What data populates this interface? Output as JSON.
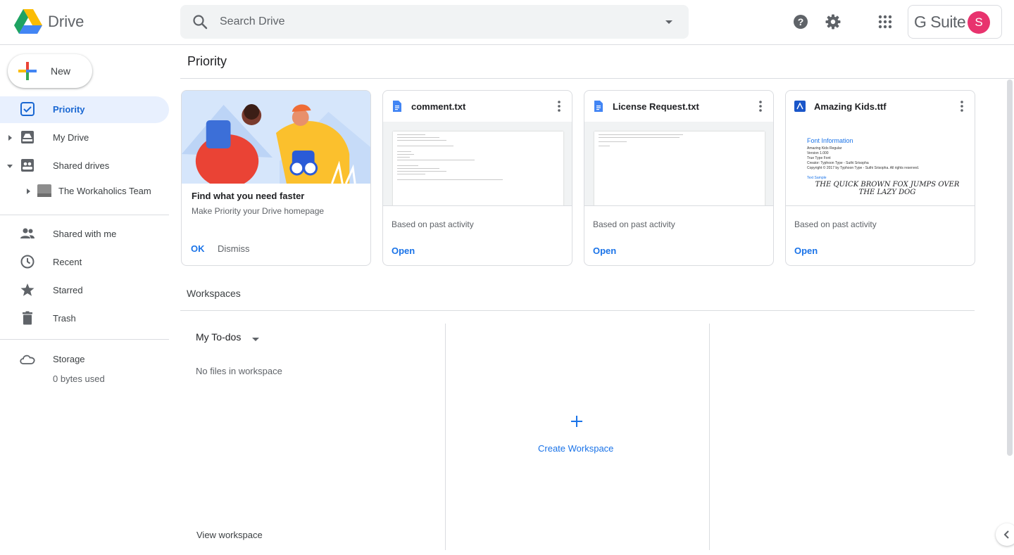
{
  "app": {
    "brand": "Drive"
  },
  "search": {
    "placeholder": "Search Drive"
  },
  "header": {
    "gsuite_label": "G Suite",
    "avatar_initial": "S"
  },
  "sidebar": {
    "new_label": "New",
    "items": [
      {
        "label": "Priority",
        "icon": "priority-check-icon",
        "active": true
      },
      {
        "label": "My Drive",
        "icon": "my-drive-icon"
      },
      {
        "label": "Shared drives",
        "icon": "shared-drives-icon"
      },
      {
        "label": "The Workaholics Team",
        "icon": "team-drive-icon"
      },
      {
        "label": "Shared with me",
        "icon": "people-icon"
      },
      {
        "label": "Recent",
        "icon": "clock-icon"
      },
      {
        "label": "Starred",
        "icon": "star-icon"
      },
      {
        "label": "Trash",
        "icon": "trash-icon"
      },
      {
        "label": "Storage",
        "icon": "cloud-icon"
      }
    ],
    "storage_used": "0 bytes used"
  },
  "main": {
    "title": "Priority",
    "promo": {
      "title": "Find what you need faster",
      "subtitle": "Make Priority your Drive homepage",
      "ok": "OK",
      "dismiss": "Dismiss"
    },
    "cards": [
      {
        "name": "comment.txt",
        "reason": "Based on past activity",
        "action": "Open",
        "icon": "doc-icon"
      },
      {
        "name": "License Request.txt",
        "reason": "Based on past activity",
        "action": "Open",
        "icon": "doc-icon"
      },
      {
        "name": "Amazing Kids.ttf",
        "reason": "Based on past activity",
        "action": "Open",
        "icon": "font-file-icon"
      }
    ],
    "font_preview": {
      "heading": "Font Information",
      "lines": [
        "Amazing Kids Regular",
        "Version 1.000",
        "True Type Font",
        "Creator: Typhoon Type - Suthi Srisopha",
        "Copyright © 2017 by Typhoon Type - Suthi Srisopha. All rights reserved."
      ],
      "sample_label": "Text Sample",
      "sample": "THE QUICK BROWN FOX JUMPS OVER THE LAZY DOG"
    },
    "workspaces": {
      "title": "Workspaces",
      "my_todos": "My To-dos",
      "no_files": "No files in workspace",
      "view": "View workspace",
      "create": "Create Workspace"
    }
  },
  "colors": {
    "accent": "#1a73e8",
    "active_bg": "#e8f0fe",
    "avatar": "#e8336e"
  }
}
